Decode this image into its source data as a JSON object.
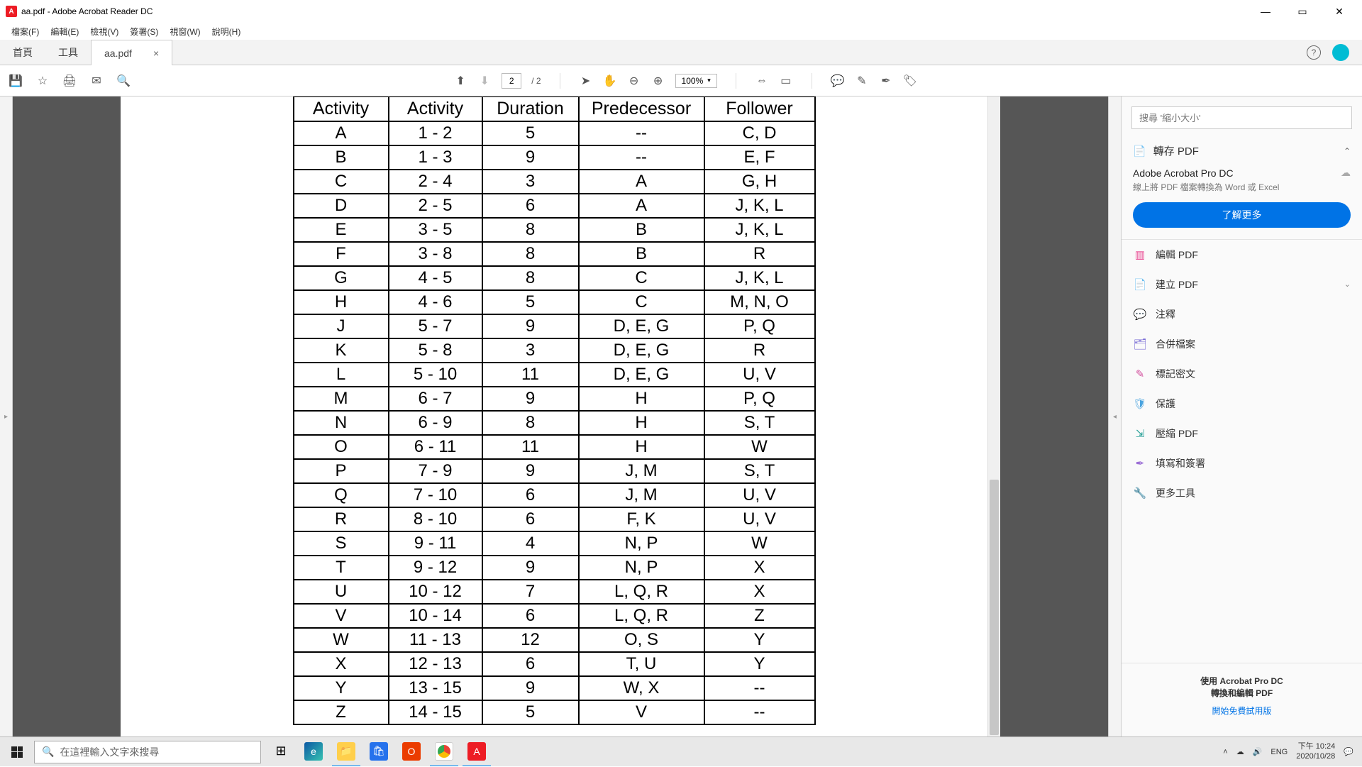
{
  "window": {
    "title": "aa.pdf - Adobe Acrobat Reader DC"
  },
  "menu": {
    "file": "檔案(F)",
    "edit": "編輯(E)",
    "view": "檢視(V)",
    "sign": "簽署(S)",
    "window": "視窗(W)",
    "help": "說明(H)"
  },
  "tabs": {
    "home": "首頁",
    "tools": "工具",
    "doc": "aa.pdf"
  },
  "toolbar": {
    "page_current": "2",
    "page_total": "/ 2",
    "zoom": "100%"
  },
  "table": {
    "headers": [
      "Activity",
      "Activity",
      "Duration",
      "Predecessor",
      "Follower"
    ],
    "rows": [
      [
        "A",
        "1 - 2",
        "5",
        "--",
        "C, D"
      ],
      [
        "B",
        "1 - 3",
        "9",
        "--",
        "E, F"
      ],
      [
        "C",
        "2 - 4",
        "3",
        "A",
        "G, H"
      ],
      [
        "D",
        "2 - 5",
        "6",
        "A",
        "J, K, L"
      ],
      [
        "E",
        "3 - 5",
        "8",
        "B",
        "J, K, L"
      ],
      [
        "F",
        "3 - 8",
        "8",
        "B",
        "R"
      ],
      [
        "G",
        "4 - 5",
        "8",
        "C",
        "J, K, L"
      ],
      [
        "H",
        "4 - 6",
        "5",
        "C",
        "M, N, O"
      ],
      [
        "J",
        "5 - 7",
        "9",
        "D, E, G",
        "P, Q"
      ],
      [
        "K",
        "5 - 8",
        "3",
        "D, E, G",
        "R"
      ],
      [
        "L",
        "5 - 10",
        "11",
        "D, E, G",
        "U, V"
      ],
      [
        "M",
        "6 - 7",
        "9",
        "H",
        "P, Q"
      ],
      [
        "N",
        "6 - 9",
        "8",
        "H",
        "S, T"
      ],
      [
        "O",
        "6 - 11",
        "11",
        "H",
        "W"
      ],
      [
        "P",
        "7 - 9",
        "9",
        "J, M",
        "S, T"
      ],
      [
        "Q",
        "7 - 10",
        "6",
        "J, M",
        "U, V"
      ],
      [
        "R",
        "8 - 10",
        "6",
        "F, K",
        "U, V"
      ],
      [
        "S",
        "9 - 11",
        "4",
        "N, P",
        "W"
      ],
      [
        "T",
        "9 - 12",
        "9",
        "N, P",
        "X"
      ],
      [
        "U",
        "10 - 12",
        "7",
        "L, Q, R",
        "X"
      ],
      [
        "V",
        "10 - 14",
        "6",
        "L, Q, R",
        "Z"
      ],
      [
        "W",
        "11 - 13",
        "12",
        "O, S",
        "Y"
      ],
      [
        "X",
        "12 - 13",
        "6",
        "T, U",
        "Y"
      ],
      [
        "Y",
        "13 - 15",
        "9",
        "W, X",
        "--"
      ],
      [
        "Z",
        "14 - 15",
        "5",
        "V",
        "--"
      ]
    ]
  },
  "panel": {
    "search_placeholder": "搜尋 '縮小大小'",
    "convert": "轉存 PDF",
    "pro_title": "Adobe Acrobat Pro DC",
    "pro_desc": "線上將 PDF 檔案轉換為 Word 或 Excel",
    "learn_more": "了解更多",
    "edit": "編輯 PDF",
    "create": "建立 PDF",
    "comment": "注釋",
    "combine": "合併檔案",
    "redact": "標記密文",
    "protect": "保護",
    "compress": "壓縮 PDF",
    "fillsign": "填寫和簽署",
    "moretools": "更多工具",
    "promo_l1": "使用 Acrobat Pro DC",
    "promo_l2": "轉換和編輯 PDF",
    "promo_link": "開始免費試用版"
  },
  "taskbar": {
    "search_placeholder": "在這裡輸入文字來搜尋",
    "lang": "ENG",
    "time": "下午 10:24",
    "date": "2020/10/28"
  }
}
